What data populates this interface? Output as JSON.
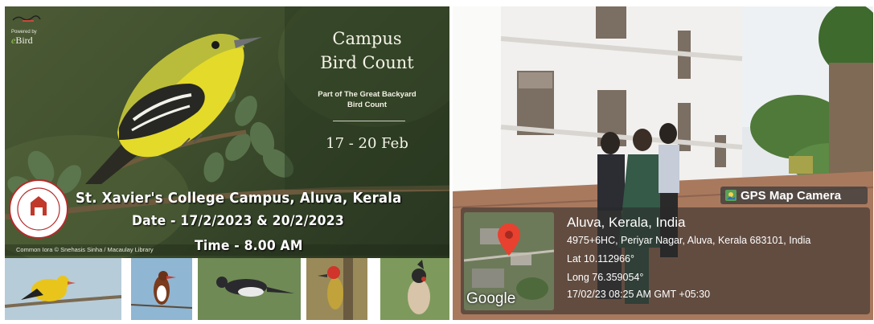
{
  "poster": {
    "logo_gbbc_text": "",
    "powered_by": "Powered by",
    "ebird_e": "e",
    "ebird_rest": "Bird",
    "title_line1": "Campus",
    "title_line2": "Bird Count",
    "subtitle_line1": "Part of The Great Backyard",
    "subtitle_line2": "Bird Count",
    "dates": "17 - 20 Feb",
    "campus": "St. Xavier's College Campus, Aluva, Kerala",
    "date_line": "Date - 17/2/2023 & 20/2/2023",
    "time_line": "Time - 8.00 AM",
    "credit": "Common Iora © Snehasis Sinha / Macaulay Library",
    "seal_text_top": "SAINT XAVIER'S",
    "seal_text_bottom": "COLLEGE FOR WOMEN ALUVA",
    "seal_motto": "On the path of knowledge love & service"
  },
  "gps": {
    "badge": "GPS Map Camera",
    "location": "Aluva, Kerala, India",
    "address": "4975+6HC, Periyar Nagar, Aluva, Kerala 683101, India",
    "lat": "Lat 10.112966°",
    "long": "Long 76.359054°",
    "timestamp": "17/02/23 08:25 AM GMT +05:30",
    "map_brand": "Google"
  },
  "colors": {
    "poster_green": "#3f4f2d",
    "iora_yellow": "#e6d92a",
    "map_pin": "#e8412f"
  }
}
